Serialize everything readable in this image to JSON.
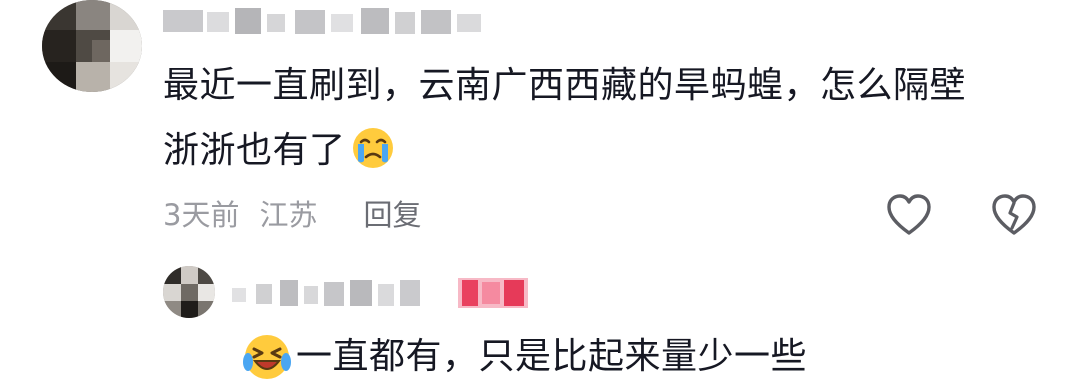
{
  "comment": {
    "text_line1": "最近一直刷到，云南广西西藏的旱蚂蝗，怎么隔壁",
    "text_line2": "浙浙也有了",
    "emoji": "crying-face-icon",
    "time": "3天前",
    "location": "江苏",
    "reply_label": "回复"
  },
  "reply": {
    "emoji": "laughing-crying-face-icon",
    "text": "一直都有，只是比起来量少一些"
  },
  "colors": {
    "text": "#161823",
    "meta": "#9a9ba1",
    "author_tag": "#fe2c55"
  }
}
